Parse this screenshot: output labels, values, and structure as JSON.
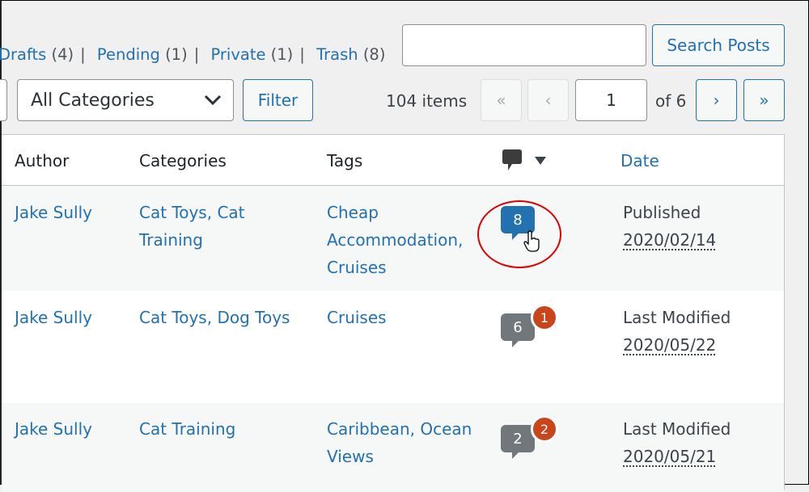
{
  "subsubsub": [
    {
      "label": "Drafts",
      "count": "(4)"
    },
    {
      "label": "Pending",
      "count": "(1)"
    },
    {
      "label": "Private",
      "count": "(1)"
    },
    {
      "label": "Trash",
      "count": "(8)"
    }
  ],
  "search": {
    "value": "",
    "button": "Search Posts"
  },
  "filters": {
    "category": "All Categories",
    "filter_button": "Filter"
  },
  "pagination": {
    "items": "104 items",
    "first": "«",
    "prev": "‹",
    "current": "1",
    "of": "of 6",
    "next": "›",
    "last": "»"
  },
  "columns": {
    "author": "Author",
    "categories": "Categories",
    "tags": "Tags",
    "comments_icon": "comment-bubble-icon",
    "date": "Date"
  },
  "rows": [
    {
      "author": "Jake Sully",
      "categories": "Cat Toys, Cat Training",
      "tags": "Cheap Accommodation, Cruises",
      "comments": "8",
      "pending": "",
      "status": "Published",
      "date": "2020/02/14"
    },
    {
      "author": "Jake Sully",
      "categories": "Cat Toys, Dog Toys",
      "tags": "Cruises",
      "comments": "6",
      "pending": "1",
      "status": "Last Modified",
      "date": "2020/05/22"
    },
    {
      "author": "Jake Sully",
      "categories": "Cat Training",
      "tags": "Caribbean, Ocean Views",
      "comments": "2",
      "pending": "2",
      "status": "Last Modified",
      "date": "2020/05/21"
    }
  ],
  "colors": {
    "link": "#2271b1",
    "bubble_active": "#2271b1",
    "bubble": "#72777c",
    "pending": "#c9461c",
    "highlight": "#e00000"
  }
}
